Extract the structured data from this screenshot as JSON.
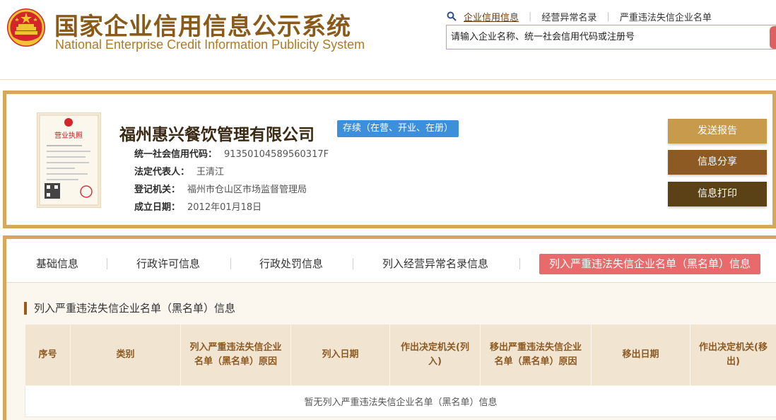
{
  "header": {
    "title_cn": "国家企业信用信息公示系统",
    "title_en": "National Enterprise Credit Information Publicity System",
    "nav": [
      {
        "label": "企业信用信息",
        "active": true
      },
      {
        "label": "经营异常名录",
        "active": false
      },
      {
        "label": "严重违法失信企业名单",
        "active": false
      }
    ],
    "search_placeholder": "请输入企业名称、统一社会信用代码或注册号"
  },
  "company": {
    "name": "福州惠兴餐饮管理有限公司",
    "status": "存续（在营、开业、在册）",
    "license_title": "营业执照",
    "fields": [
      {
        "label": "统一社会信用代码：",
        "value": "91350104589560317F"
      },
      {
        "label": "法定代表人：",
        "value": "王清江"
      },
      {
        "label": "登记机关：",
        "value": "福州市仓山区市场监督管理局"
      },
      {
        "label": "成立日期：",
        "value": "2012年01月18日"
      }
    ],
    "buttons": {
      "report": "发送报告",
      "share": "信息分享",
      "print": "信息打印"
    }
  },
  "tabs": [
    {
      "label": "基础信息",
      "active": false
    },
    {
      "label": "行政许可信息",
      "active": false
    },
    {
      "label": "行政处罚信息",
      "active": false
    },
    {
      "label": "列入经营异常名录信息",
      "active": false
    },
    {
      "label": "列入严重违法失信企业名单（黑名单）信息",
      "active": true
    }
  ],
  "section": {
    "title": "列入严重违法失信企业名单（黑名单）信息",
    "columns": [
      "序号",
      "类别",
      "列入严重违法失信企业名单（黑名单）原因",
      "列入日期",
      "作出决定机关(列入)",
      "移出严重违法失信企业名单（黑名单）原因",
      "移出日期",
      "作出决定机关(移出)"
    ],
    "empty_message": "暂无列入严重违法失信企业名单（黑名单）信息"
  },
  "colors": {
    "brand_brown": "#8a5a18",
    "card_border": "#d7a85c",
    "status_blue": "#3d8fdc",
    "active_tab": "#e96a6a"
  }
}
